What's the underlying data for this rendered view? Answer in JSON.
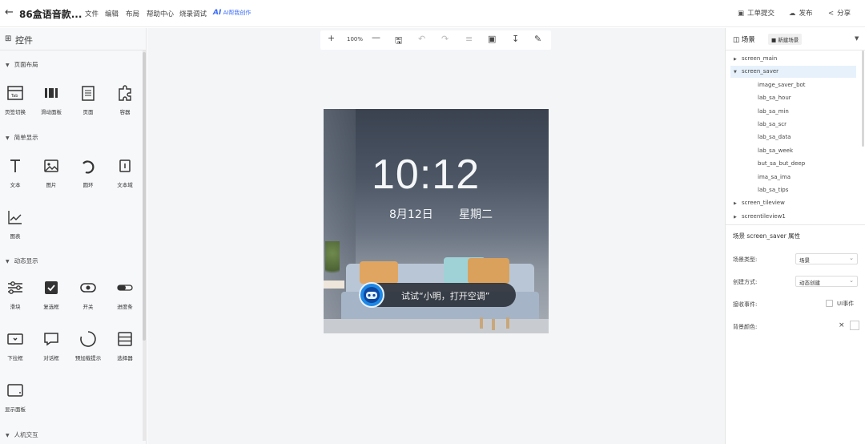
{
  "header": {
    "back_icon": "back-arrow-icon",
    "title": "86盒语音款...",
    "menu": [
      "文件",
      "编辑",
      "布局",
      "帮助中心",
      "烧录调试"
    ],
    "ai_label": "AI",
    "ai_create": "AI帮我创作",
    "right_buttons": [
      {
        "label": "工单提交",
        "icon": "ticket-icon"
      },
      {
        "label": "发布",
        "icon": "cloud-publish-icon"
      },
      {
        "label": "分享",
        "icon": "share-icon"
      }
    ]
  },
  "left_panel": {
    "title": "控件",
    "sections": [
      {
        "title": "页面布局",
        "items": [
          "页签切换",
          "滑动面板",
          "页面",
          "容器"
        ]
      },
      {
        "title": "简单显示",
        "items": [
          "文本",
          "图片",
          "圆环",
          "文本域",
          "图表"
        ]
      },
      {
        "title": "动态显示",
        "items": [
          "滑块",
          "复选框",
          "开关",
          "进度条",
          "下拉框",
          "对话框",
          "预加载提示",
          "选择器",
          "显示面板"
        ]
      },
      {
        "title": "人机交互",
        "items": []
      }
    ]
  },
  "toolbar": {
    "zoom": "100%",
    "tools": [
      "plus-icon",
      "minus-icon",
      "save-icon",
      "undo-icon",
      "redo-icon",
      "align-icon",
      "import-icon",
      "download-icon",
      "pen-icon"
    ]
  },
  "screen": {
    "time": "10:12",
    "date": "8月12日",
    "week": "星期二",
    "tips": "试试“小明，打开空调”"
  },
  "right_panel": {
    "tab": "场景",
    "new_scene": "新建场景",
    "tree": [
      {
        "label": "screen_main",
        "level": 0,
        "expanded": false,
        "selected": false
      },
      {
        "label": "screen_saver",
        "level": 0,
        "expanded": true,
        "selected": true
      },
      {
        "label": "image_saver_bot",
        "level": 1
      },
      {
        "label": "lab_sa_hour",
        "level": 1
      },
      {
        "label": "lab_sa_min",
        "level": 1
      },
      {
        "label": "lab_sa_scr",
        "level": 1
      },
      {
        "label": "lab_sa_data",
        "level": 1
      },
      {
        "label": "lab_sa_week",
        "level": 1
      },
      {
        "label": "but_sa_but_deep",
        "level": 1
      },
      {
        "label": "ima_sa_ima",
        "level": 1
      },
      {
        "label": "lab_sa_tips",
        "level": 1
      },
      {
        "label": "screen_tileview",
        "level": 0,
        "expanded": false,
        "selected": false
      },
      {
        "label": "screentileview1",
        "level": 0,
        "expanded": false,
        "selected": false
      }
    ],
    "properties": {
      "title": "场景 screen_saver 属性",
      "scene_type_label": "场景类型:",
      "scene_type_value": "场景",
      "create_mode_label": "创建方式:",
      "create_mode_value": "动态创建",
      "receive_event_label": "接收事件:",
      "ui_event_label": "UI事件",
      "bg_color_label": "背景颜色:",
      "bg_clear": "×"
    }
  },
  "colors": {
    "accent": "#3b6cf6",
    "selected_row": "#e6f1fb",
    "robot_blue": "#1e88e5"
  }
}
